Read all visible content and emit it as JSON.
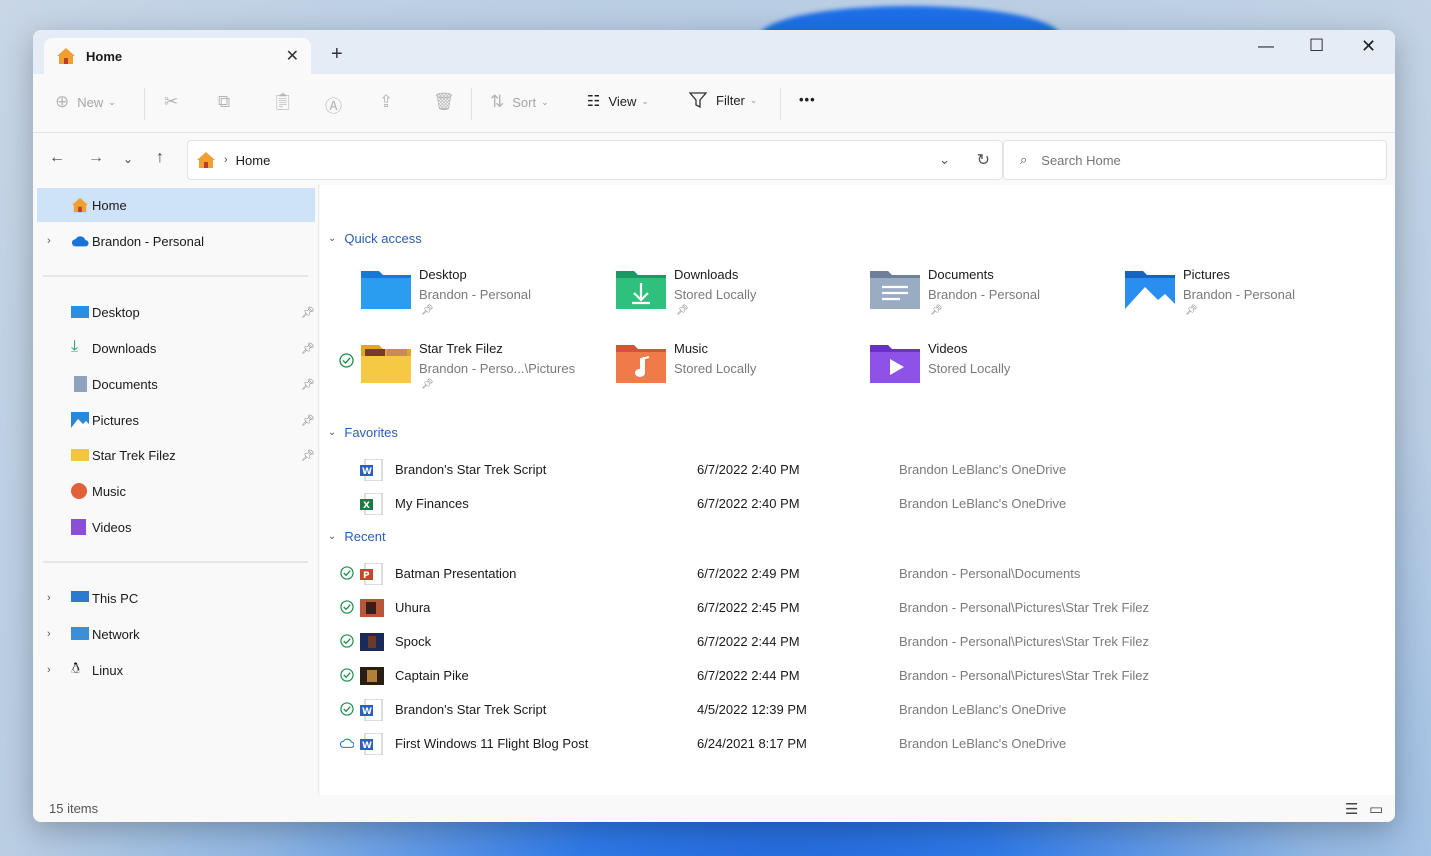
{
  "tab": {
    "title": "Home"
  },
  "toolbar": {
    "new_label": "New",
    "sort_label": "Sort",
    "view_label": "View",
    "filter_label": "Filter",
    "more_label": "•••"
  },
  "address": {
    "crumb": "Home"
  },
  "search": {
    "placeholder": "Search Home"
  },
  "sidebar": {
    "home": "Home",
    "onedrive": "Brandon - Personal",
    "pinned": [
      {
        "label": "Desktop"
      },
      {
        "label": "Downloads"
      },
      {
        "label": "Documents"
      },
      {
        "label": "Pictures"
      },
      {
        "label": "Star Trek Filez"
      },
      {
        "label": "Music"
      },
      {
        "label": "Videos"
      }
    ],
    "bottom": [
      {
        "label": "This PC"
      },
      {
        "label": "Network"
      },
      {
        "label": "Linux"
      }
    ]
  },
  "quick_access": {
    "header": "Quick access",
    "items": [
      {
        "name": "Desktop",
        "sub": "Brandon - Personal"
      },
      {
        "name": "Downloads",
        "sub": "Stored Locally"
      },
      {
        "name": "Documents",
        "sub": "Brandon - Personal"
      },
      {
        "name": "Pictures",
        "sub": "Brandon - Personal"
      },
      {
        "name": "Star Trek Filez",
        "sub": "Brandon - Perso...\\Pictures"
      },
      {
        "name": "Music",
        "sub": "Stored Locally"
      },
      {
        "name": "Videos",
        "sub": "Stored Locally"
      }
    ]
  },
  "favorites": {
    "header": "Favorites",
    "rows": [
      {
        "name": "Brandon's Star Trek Script",
        "date": "6/7/2022 2:40 PM",
        "location": "Brandon LeBlanc's OneDrive"
      },
      {
        "name": "My Finances",
        "date": "6/7/2022 2:40 PM",
        "location": "Brandon LeBlanc's OneDrive"
      }
    ]
  },
  "recent": {
    "header": "Recent",
    "rows": [
      {
        "name": "Batman Presentation",
        "date": "6/7/2022 2:49 PM",
        "location": "Brandon - Personal\\Documents"
      },
      {
        "name": "Uhura",
        "date": "6/7/2022 2:45 PM",
        "location": "Brandon - Personal\\Pictures\\Star Trek Filez"
      },
      {
        "name": "Spock",
        "date": "6/7/2022 2:44 PM",
        "location": "Brandon - Personal\\Pictures\\Star Trek Filez"
      },
      {
        "name": "Captain Pike",
        "date": "6/7/2022 2:44 PM",
        "location": "Brandon - Personal\\Pictures\\Star Trek Filez"
      },
      {
        "name": "Brandon's Star Trek Script",
        "date": "4/5/2022 12:39 PM",
        "location": "Brandon LeBlanc's OneDrive"
      },
      {
        "name": "First Windows 11 Flight Blog Post",
        "date": "6/24/2021 8:17 PM",
        "location": "Brandon LeBlanc's OneDrive"
      }
    ]
  },
  "status": {
    "count": "15 items"
  },
  "colors": {
    "accent": "#2a5db8",
    "selected": "#cfe3f8",
    "folder": "#f4c542"
  }
}
